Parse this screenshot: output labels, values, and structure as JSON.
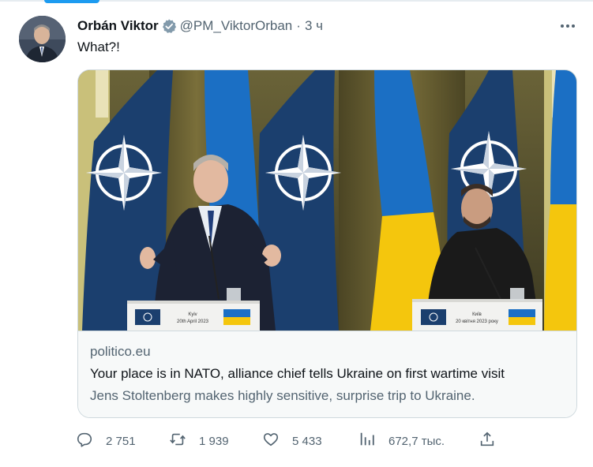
{
  "author": {
    "name": "Orbán Viktor",
    "handle": "@PM_ViktorOrban",
    "separator": "·",
    "time": "3 ч"
  },
  "tweet": {
    "text": "What?!"
  },
  "card": {
    "domain": "politico.eu",
    "title": "Your place is in NATO, alliance chief tells Ukraine on first wartime visit",
    "description": "Jens Stoltenberg makes highly sensitive, surprise trip to Ukraine.",
    "podium_left": {
      "line1": "Kyiv",
      "line2": "20th April 2023"
    },
    "podium_right": {
      "line1": "Київ",
      "line2": "20 квітня 2023 року"
    }
  },
  "actions": {
    "replies": "2 751",
    "reposts": "1 939",
    "likes": "5 433",
    "views": "672,7 тыс."
  },
  "icons": {
    "verified": "verified-badge-icon",
    "more": "more-dots-icon",
    "reply": "reply-icon",
    "repost": "repost-icon",
    "like": "heart-icon",
    "views": "views-chart-icon",
    "share": "share-icon"
  },
  "colors": {
    "accent": "#1d9bf0",
    "text_secondary": "#536471",
    "nato_blue": "#1b3f6e",
    "ukraine_blue": "#1b6fc4",
    "ukraine_yellow": "#f4c60d"
  }
}
